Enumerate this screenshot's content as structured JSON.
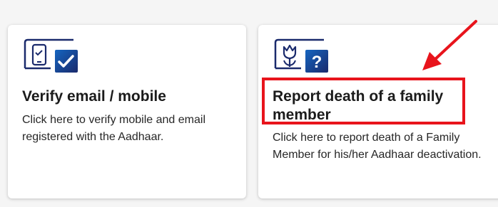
{
  "cards": [
    {
      "title": "Verify email / mobile",
      "description": "Click here to verify mobile and email registered with the Aadhaar.",
      "icon": "phone-check-icon"
    },
    {
      "title": "Report death of a family member",
      "description": "Click here to report death of a Family Member for his/her Aadhaar deactivation.",
      "icon": "flower-question-icon"
    }
  ],
  "annotation": {
    "highlight_color": "#e8141c",
    "arrow_color": "#e8141c"
  },
  "colors": {
    "icon_navy": "#1a2a6c",
    "icon_blue": "#1565c0"
  }
}
